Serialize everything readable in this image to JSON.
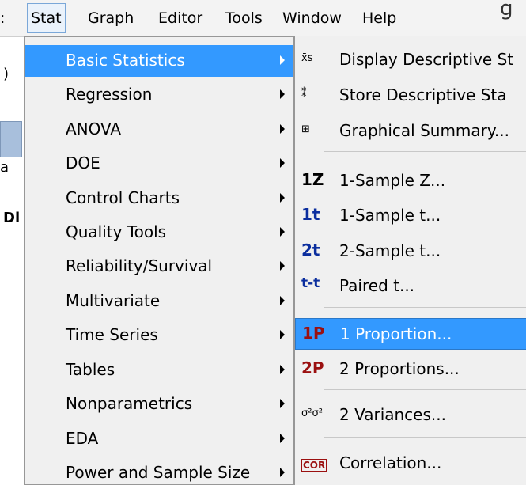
{
  "menubar": {
    "items": [
      {
        "label": ":"
      },
      {
        "label": "Stat"
      },
      {
        "label": "Graph"
      },
      {
        "label": "Editor"
      },
      {
        "label": "Tools"
      },
      {
        "label": "Window"
      },
      {
        "label": "Help"
      }
    ],
    "right_fragment": "g"
  },
  "background": {
    "fragments": [
      ")",
      "a",
      "Di"
    ]
  },
  "stat_menu": {
    "items": [
      {
        "label": "Basic Statistics"
      },
      {
        "label": "Regression"
      },
      {
        "label": "ANOVA"
      },
      {
        "label": "DOE"
      },
      {
        "label": "Control Charts"
      },
      {
        "label": "Quality Tools"
      },
      {
        "label": "Reliability/Survival"
      },
      {
        "label": "Multivariate"
      },
      {
        "label": "Time Series"
      },
      {
        "label": "Tables"
      },
      {
        "label": "Nonparametrics"
      },
      {
        "label": "EDA"
      },
      {
        "label": "Power and Sample Size"
      }
    ]
  },
  "basic_stats_menu": {
    "items": [
      {
        "icon": "x̄s",
        "label": "Display Descriptive St"
      },
      {
        "icon": "⁑",
        "label": "Store Descriptive Sta"
      },
      {
        "icon": "⊞",
        "label": "Graphical Summary..."
      },
      {
        "icon": "1Z",
        "label": "1-Sample Z..."
      },
      {
        "icon": "1t",
        "label": "1-Sample t..."
      },
      {
        "icon": "2t",
        "label": "2-Sample t..."
      },
      {
        "icon": "t-t",
        "label": "Paired t..."
      },
      {
        "icon": "1P",
        "label": "1 Proportion..."
      },
      {
        "icon": "2P",
        "label": "2 Proportions..."
      },
      {
        "icon": "σ²σ²",
        "label": "2 Variances..."
      },
      {
        "icon": "COR",
        "label": "Correlation..."
      }
    ]
  }
}
